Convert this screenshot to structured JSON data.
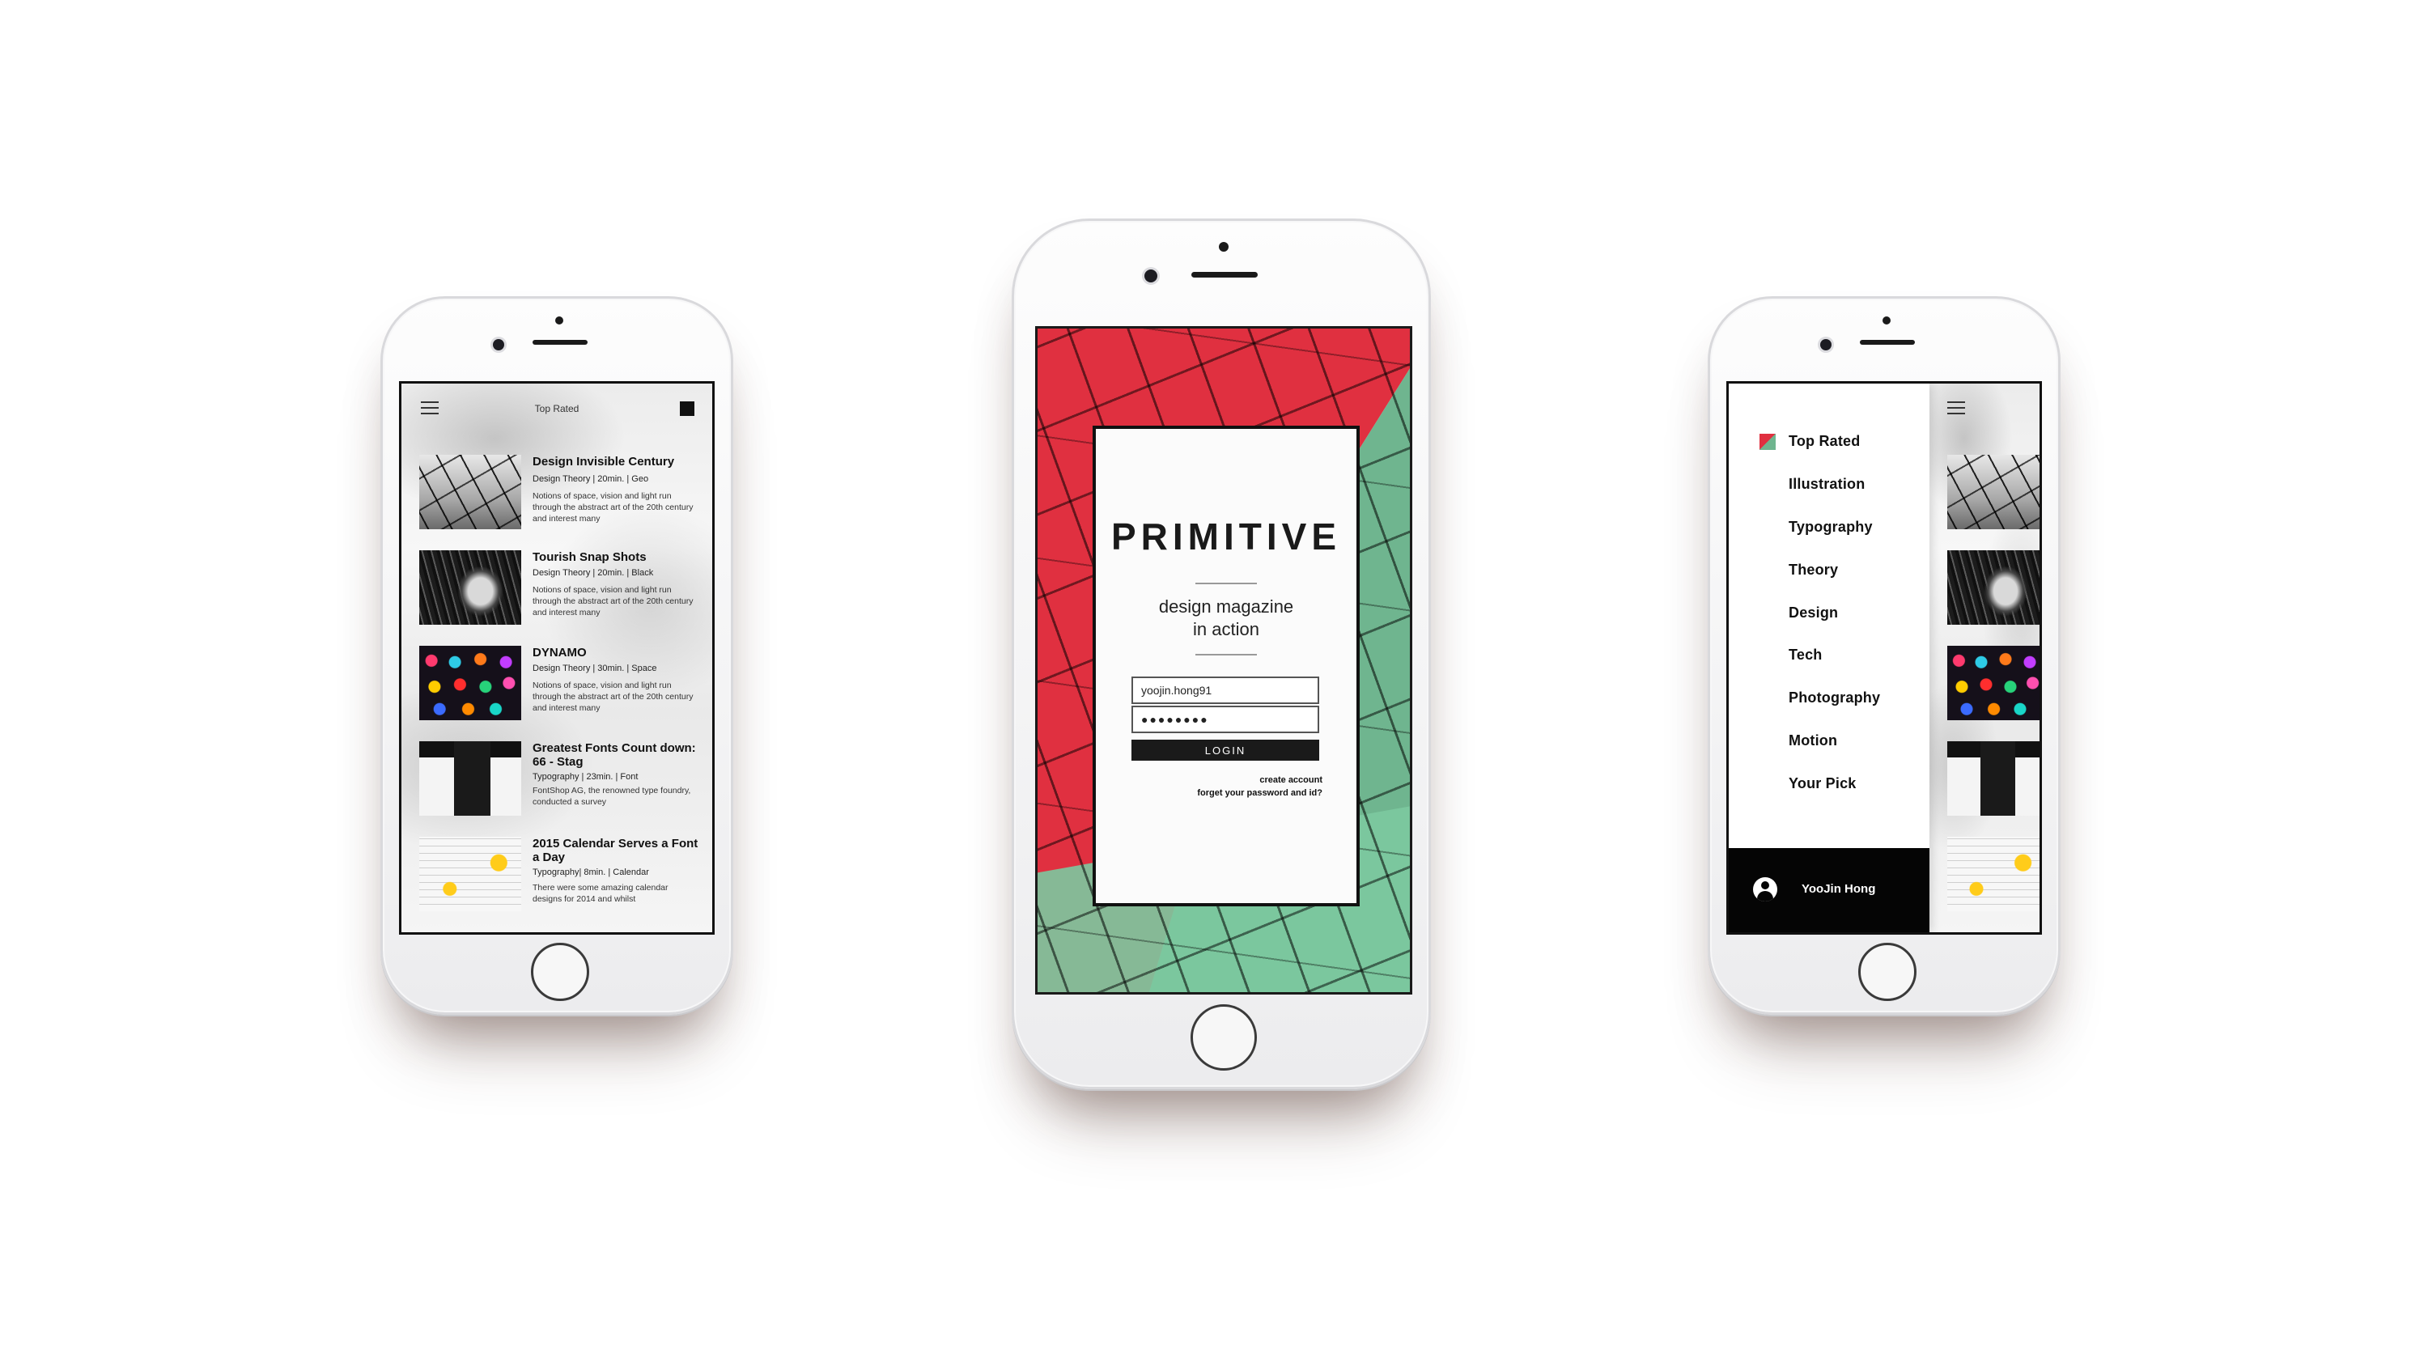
{
  "left_screen": {
    "header_title": "Top Rated",
    "articles": [
      {
        "title": "Design Invisible Century",
        "meta": "Design Theory |  20min.  |  Geo",
        "desc": "Notions of space, vision and light run through the abstract art of the 20th century and interest many"
      },
      {
        "title": "Tourish Snap Shots",
        "meta": "Design Theory |  20min.  |  Black",
        "desc": "Notions of space, vision and light run through the abstract art of the 20th century and interest many"
      },
      {
        "title": "DYNAMO",
        "meta": "Design Theory |  30min.  |  Space",
        "desc": "Notions of space, vision and light run through the abstract art of the 20th century and interest many"
      },
      {
        "title": "Greatest Fonts Count down: 66 - Stag",
        "meta": "Typography |  23min.  |  Font",
        "desc": "FontShop AG, the renowned type foundry, conducted a survey"
      },
      {
        "title": "2015 Calendar Serves a Font a Day",
        "meta": "Typography|  8min.  |  Calendar",
        "desc": "There were some amazing calendar designs for 2014 and whilst"
      }
    ]
  },
  "center_screen": {
    "brand": "PRIMITIVE",
    "tagline_line1": "design magazine",
    "tagline_line2": "in action",
    "username_value": "yoojin.hong91",
    "password_value": "●●●●●●●●",
    "login_label": "LOGIN",
    "create_account": "create account",
    "forgot": "forget your password and id?"
  },
  "right_screen": {
    "menu_items": [
      "Top Rated",
      "Illustration",
      "Typography",
      "Theory",
      "Design",
      "Tech",
      "Photography",
      "Motion",
      "Your Pick"
    ],
    "user_name": "YooJin Hong"
  },
  "colors": {
    "accent_red": "#e03040",
    "accent_green": "#6fb58f",
    "dark": "#111111"
  },
  "icons": [
    "hamburger-menu-icon",
    "square-icon",
    "user-avatar-icon",
    "brand-flag-icon"
  ]
}
